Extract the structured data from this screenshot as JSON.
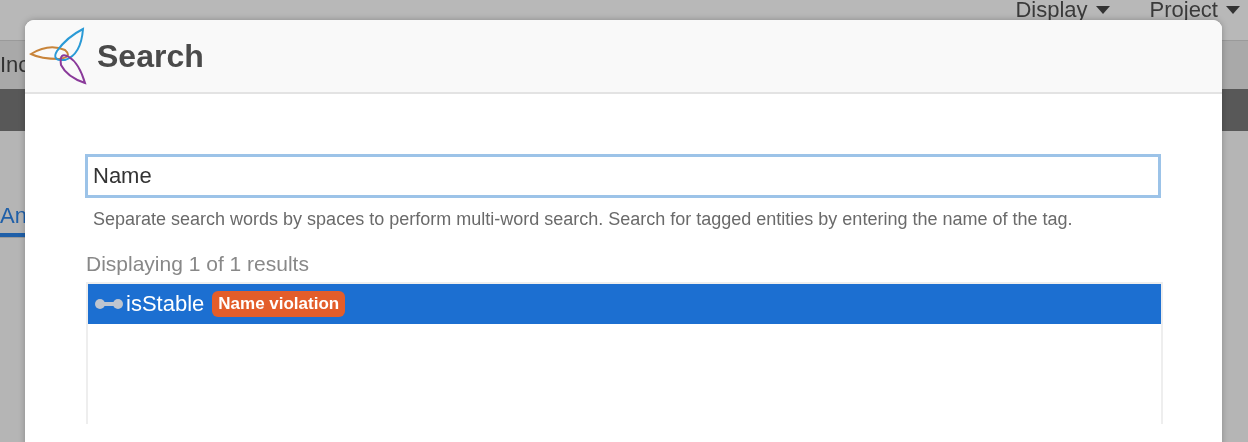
{
  "menu": [
    {
      "label": "Display"
    },
    {
      "label": "Project"
    }
  ],
  "toolbar": {
    "label": "Inc"
  },
  "tabs": [
    {
      "label": "An",
      "selected": true
    }
  ],
  "dialog": {
    "title": "Search",
    "search": {
      "value": "Name"
    },
    "help": "Separate search words by spaces to perform multi-word search. Search for tagged entities by entering the name of the tag.",
    "result_count": "Displaying 1 of 1 results",
    "results": [
      {
        "name": "isStable",
        "tag": "Name violation",
        "selected": true
      }
    ]
  }
}
